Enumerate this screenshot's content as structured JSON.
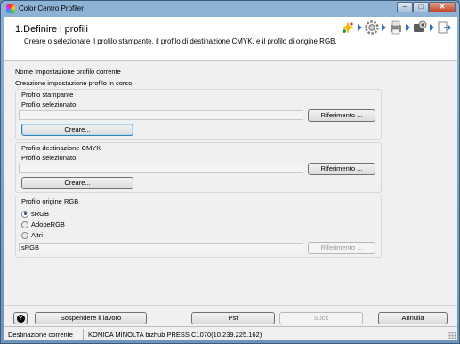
{
  "window": {
    "title": "Color Centro Profiler",
    "minimize": "–",
    "maximize": "□",
    "close": "✕"
  },
  "header": {
    "step_title": "1.Definire i profili",
    "step_description": "Creare o selezionare il profilo stampante, il profilo di destinazione CMYK, e il profilo di origine RGB.",
    "step_icons": [
      "sparkle-icon",
      "gear-icon",
      "printer-icon",
      "scanner-icon",
      "export-icon"
    ]
  },
  "info": {
    "current_setting_label": "Nome Impostazione profilo corrente",
    "creating_label": "Creazione impostazione profilo in corso"
  },
  "printer_profile": {
    "title": "Profilo stampante",
    "selected_label": "Profilo selezionato",
    "selected_value": "",
    "reference_button": "Riferimento ...",
    "create_button": "Creare..."
  },
  "cmyk_profile": {
    "title": "Profilo destinazione CMYK",
    "selected_label": "Profilo selezionato",
    "selected_value": "",
    "reference_button": "Riferimento ...",
    "create_button": "Creare..."
  },
  "rgb_profile": {
    "title": "Profilo origine RGB",
    "options": [
      {
        "label": "sRGB",
        "checked": true
      },
      {
        "label": "AdobeRGB",
        "checked": false
      },
      {
        "label": "Altri",
        "checked": false
      }
    ],
    "selected_value": "sRGB",
    "reference_button": "Riferimento ...",
    "reference_enabled": false
  },
  "footer": {
    "help_glyph": "?",
    "suspend_button": "Sospendere il lavoro",
    "prev_button": "Pst",
    "next_button": "Succ",
    "cancel_button": "Annulla"
  },
  "status": {
    "label": "Destinazione corrente",
    "value": "KONICA MINOLTA bizhub PRESS C1070(10.239.225.162)"
  },
  "colors": {
    "accent": "#2a6fc9",
    "titlebar": "#8fb3d4"
  }
}
